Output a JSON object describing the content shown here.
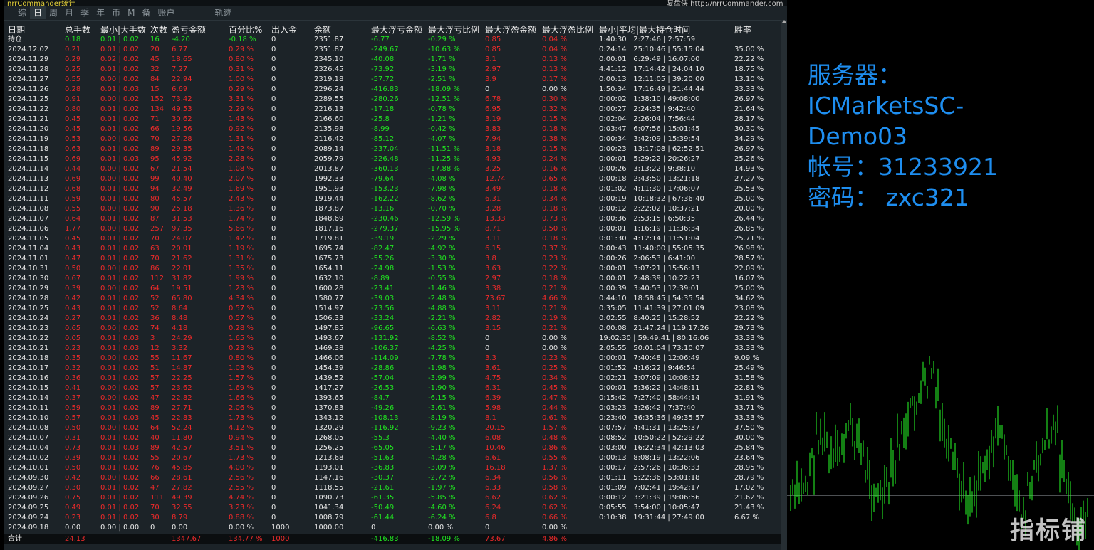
{
  "window": {
    "title_snippet": "nrrCommander统计",
    "site_snippet": "复盘侠 http://nrrCommander.com"
  },
  "tabs": [
    "综",
    "日",
    "周",
    "月",
    "季",
    "年",
    "币",
    "M",
    "备",
    "账户",
    "轨迹"
  ],
  "active_tab": "日",
  "headers": [
    "日期",
    "总手数",
    "最小|大手数",
    "次数",
    "盈亏金额",
    "百分比%",
    "出入金",
    "余额",
    "最大浮亏金额",
    "最大浮亏比例",
    "最大浮盈金额",
    "最大浮盈比例",
    "最小|平均|最大持仓时间",
    "胜率"
  ],
  "position_row": [
    "持仓",
    "0.18",
    "0.01 | 0.02",
    "16",
    "-4.20",
    "-0.18 %",
    "0",
    "2351.87",
    "-6.77",
    "-0.29 %",
    "0.85",
    "0.04 %",
    "1:40:30 | 2:27:46 | 2:57:59",
    ""
  ],
  "rows": [
    [
      "2024.12.02",
      "0.21",
      "0.01 | 0.02",
      "20",
      "6.77",
      "0.29 %",
      "0",
      "2351.87",
      "-249.67",
      "-10.63 %",
      "0.85",
      "0.04 %",
      "0:24:14 | 25:10:46 | 55:15:04",
      "35.00 %"
    ],
    [
      "2024.11.29",
      "0.29",
      "0.02 | 0.02",
      "45",
      "18.65",
      "0.80 %",
      "0",
      "2345.10",
      "-40.08",
      "-1.71 %",
      "3.1",
      "0.13 %",
      "0:00:01 | 6:29:49 | 16:07:00",
      "22.22 %"
    ],
    [
      "2024.11.28",
      "0.25",
      "0.01 | 0.02",
      "32",
      "7.27",
      "0.31 %",
      "0",
      "2326.45",
      "-73.92",
      "-3.19 %",
      "2.97",
      "0.13 %",
      "4:41:12 | 17:14:42 | 24:04:10",
      "18.75 %"
    ],
    [
      "2024.11.27",
      "0.55",
      "0.00 | 0.02",
      "84",
      "22.94",
      "1.00 %",
      "0",
      "2319.18",
      "-57.72",
      "-2.51 %",
      "3.9",
      "0.17 %",
      "0:00:13 | 12:11:05 | 39:20:00",
      "13.10 %"
    ],
    [
      "2024.11.26",
      "0.28",
      "0.01 | 0.03",
      "15",
      "6.69",
      "0.29 %",
      "0",
      "2296.24",
      "-416.83",
      "-18.09 %",
      "0",
      "0.00 %",
      "1:50:34 | 17:16:49 | 21:44:44",
      "33.33 %"
    ],
    [
      "2024.11.25",
      "0.91",
      "0.00 | 0.02",
      "152",
      "73.42",
      "3.31 %",
      "0",
      "2289.55",
      "-280.26",
      "-12.51 %",
      "6.78",
      "0.30 %",
      "0:00:02 | 1:38:10 | 49:08:00",
      "26.97 %"
    ],
    [
      "2024.11.22",
      "0.80",
      "0.01 | 0.02",
      "134",
      "49.53",
      "2.29 %",
      "0",
      "2216.13",
      "-17.18",
      "-0.78 %",
      "6.95",
      "0.32 %",
      "0:00:27 | 2:24:35 | 9:42:40",
      "21.64 %"
    ],
    [
      "2024.11.21",
      "0.45",
      "0.01 | 0.02",
      "71",
      "30.62",
      "1.43 %",
      "0",
      "2166.60",
      "-25.8",
      "-1.21 %",
      "3.19",
      "0.15 %",
      "0:02:04 | 2:26:04 | 7:56:44",
      "28.17 %"
    ],
    [
      "2024.11.20",
      "0.45",
      "0.01 | 0.02",
      "66",
      "19.56",
      "0.92 %",
      "0",
      "2135.98",
      "-8.99",
      "-0.42 %",
      "3.83",
      "0.18 %",
      "0:03:47 | 6:07:56 | 15:01:45",
      "30.30 %"
    ],
    [
      "2024.11.19",
      "0.53",
      "0.00 | 0.02",
      "70",
      "27.28",
      "1.31 %",
      "0",
      "2116.42",
      "-85.12",
      "-4.07 %",
      "7.94",
      "0.38 %",
      "0:00:34 | 3:42:09 | 15:39:54",
      "34.29 %"
    ],
    [
      "2024.11.18",
      "0.63",
      "0.01 | 0.02",
      "89",
      "29.35",
      "1.42 %",
      "0",
      "2089.14",
      "-237.04",
      "-11.51 %",
      "3.18",
      "0.15 %",
      "0:00:23 | 13:17:08 | 62:52:51",
      "26.97 %"
    ],
    [
      "2024.11.15",
      "0.69",
      "0.01 | 0.03",
      "95",
      "45.92",
      "2.28 %",
      "0",
      "2059.79",
      "-226.48",
      "-11.25 %",
      "4.93",
      "0.24 %",
      "0:00:01 | 5:29:22 | 20:26:27",
      "25.26 %"
    ],
    [
      "2024.11.14",
      "0.44",
      "0.00 | 0.02",
      "67",
      "21.54",
      "1.08 %",
      "0",
      "2013.87",
      "-360.13",
      "-17.88 %",
      "3.25",
      "0.16 %",
      "0:00:26 | 3:13:22 | 9:38:10",
      "14.93 %"
    ],
    [
      "2024.11.13",
      "0.69",
      "0.00 | 0.02",
      "99",
      "40.40",
      "2.07 %",
      "0",
      "1992.33",
      "-79.64",
      "-4.08 %",
      "12.74",
      "0.65 %",
      "0:00:18 | 2:43:50 | 13:21:18",
      "27.27 %"
    ],
    [
      "2024.11.12",
      "0.68",
      "0.01 | 0.02",
      "94",
      "32.49",
      "1.69 %",
      "0",
      "1951.93",
      "-153.23",
      "-7.98 %",
      "3.49",
      "0.18 %",
      "0:01:02 | 4:11:30 | 17:06:07",
      "25.53 %"
    ],
    [
      "2024.11.11",
      "0.59",
      "0.01 | 0.02",
      "80",
      "45.57",
      "2.43 %",
      "0",
      "1919.44",
      "-162.22",
      "-8.62 %",
      "6.31",
      "0.34 %",
      "0:00:19 | 10:18:32 | 67:36:40",
      "25.00 %"
    ],
    [
      "2024.11.08",
      "0.55",
      "0.00 | 0.02",
      "90",
      "25.18",
      "1.36 %",
      "0",
      "1873.87",
      "-13.16",
      "-0.70 %",
      "3.28",
      "0.18 %",
      "0:00:12 | 2:22:02 | 10:37:21",
      "20.00 %"
    ],
    [
      "2024.11.07",
      "0.64",
      "0.01 | 0.02",
      "87",
      "31.53",
      "1.74 %",
      "0",
      "1848.69",
      "-230.46",
      "-12.59 %",
      "13.33",
      "0.73 %",
      "0:00:36 | 2:53:15 | 6:50:35",
      "26.44 %"
    ],
    [
      "2024.11.06",
      "1.77",
      "0.00 | 0.02",
      "257",
      "97.35",
      "5.66 %",
      "0",
      "1817.16",
      "-279.37",
      "-15.95 %",
      "8.71",
      "0.50 %",
      "0:00:01 | 1:16:19 | 11:36:34",
      "26.85 %"
    ],
    [
      "2024.11.05",
      "0.45",
      "0.01 | 0.02",
      "70",
      "24.07",
      "1.42 %",
      "0",
      "1719.81",
      "-39.19",
      "-2.29 %",
      "3.11",
      "0.18 %",
      "0:01:30 | 4:12:14 | 11:51:04",
      "25.71 %"
    ],
    [
      "2024.11.04",
      "0.43",
      "0.01 | 0.02",
      "63",
      "20.01",
      "1.19 %",
      "0",
      "1695.74",
      "-82.47",
      "-4.92 %",
      "6.15",
      "0.37 %",
      "0:00:43 | 11:40:00 | 55:05:35",
      "26.98 %"
    ],
    [
      "2024.11.01",
      "0.47",
      "0.01 | 0.02",
      "70",
      "21.62",
      "1.31 %",
      "0",
      "1675.73",
      "-55.26",
      "-3.30 %",
      "3.8",
      "0.23 %",
      "0:00:26 | 2:06:53 | 6:41:00",
      "28.57 %"
    ],
    [
      "2024.10.31",
      "0.50",
      "0.00 | 0.02",
      "86",
      "22.01",
      "1.35 %",
      "0",
      "1654.11",
      "-24.98",
      "-1.53 %",
      "3.63",
      "0.22 %",
      "0:00:01 | 3:07:21 | 15:56:13",
      "22.09 %"
    ],
    [
      "2024.10.30",
      "0.67",
      "0.01 | 0.02",
      "112",
      "31.82",
      "1.99 %",
      "0",
      "1632.10",
      "-8.89",
      "-0.55 %",
      "2.97",
      "0.18 %",
      "0:00:01 | 2:48:39 | 10:22:23",
      "16.07 %"
    ],
    [
      "2024.10.29",
      "0.39",
      "0.00 | 0.02",
      "64",
      "19.51",
      "1.23 %",
      "0",
      "1600.28",
      "-23.41",
      "-1.46 %",
      "3.38",
      "0.21 %",
      "0:00:39 | 3:40:53 | 12:39:01",
      "25.00 %"
    ],
    [
      "2024.10.28",
      "0.42",
      "0.01 | 0.02",
      "52",
      "65.80",
      "4.34 %",
      "0",
      "1580.77",
      "-39.03",
      "-2.48 %",
      "73.67",
      "4.66 %",
      "0:44:10 | 18:58:45 | 54:35:54",
      "34.62 %"
    ],
    [
      "2024.10.25",
      "0.43",
      "0.01 | 0.02",
      "52",
      "8.64",
      "0.57 %",
      "0",
      "1514.97",
      "-73.56",
      "-4.88 %",
      "3.11",
      "0.21 %",
      "0:35:05 | 11:41:39 | 27:01:09",
      "23.08 %"
    ],
    [
      "2024.10.24",
      "0.27",
      "0.01 | 0.02",
      "36",
      "8.48",
      "0.57 %",
      "0",
      "1506.33",
      "-33.24",
      "-2.21 %",
      "2.82",
      "0.19 %",
      "0:02:55 | 8:40:25 | 15:28:52",
      "22.22 %"
    ],
    [
      "2024.10.23",
      "0.65",
      "0.00 | 0.02",
      "74",
      "4.18",
      "0.28 %",
      "0",
      "1497.85",
      "-96.65",
      "-6.63 %",
      "3.15",
      "0.21 %",
      "0:00:08 | 21:47:24 | 119:17:26",
      "29.73 %"
    ],
    [
      "2024.10.22",
      "0.05",
      "0.01 | 0.03",
      "3",
      "24.29",
      "1.65 %",
      "0",
      "1493.67",
      "-131.92",
      "-8.52 %",
      "0",
      "0.00 %",
      "19:02:30 | 59:49:41 | 80:16:06",
      "33.33 %"
    ],
    [
      "2024.10.21",
      "0.23",
      "0.01 | 0.03",
      "12",
      "3.32",
      "0.23 %",
      "0",
      "1469.38",
      "-106.37",
      "-4.25 %",
      "0",
      "0.00 %",
      "2:05:55 | 50:01:04 | 73:10:07",
      "33.33 %"
    ],
    [
      "2024.10.18",
      "0.35",
      "0.00 | 0.02",
      "55",
      "11.67",
      "0.80 %",
      "0",
      "1466.06",
      "-114.09",
      "-7.78 %",
      "3.3",
      "0.23 %",
      "0:00:01 | 7:40:48 | 12:06:49",
      "9.09 %"
    ],
    [
      "2024.10.17",
      "0.32",
      "0.01 | 0.02",
      "51",
      "14.87",
      "1.03 %",
      "0",
      "1454.39",
      "-28.86",
      "-1.98 %",
      "3.61",
      "0.25 %",
      "0:01:52 | 4:16:22 | 9:46:54",
      "25.49 %"
    ],
    [
      "2024.10.16",
      "0.36",
      "0.01 | 0.02",
      "57",
      "22.25",
      "1.57 %",
      "0",
      "1439.52",
      "-57.04",
      "-3.99 %",
      "4.75",
      "0.34 %",
      "0:02:21 | 3:07:09 | 10:08:32",
      "31.58 %"
    ],
    [
      "2024.10.15",
      "0.41",
      "0.00 | 0.02",
      "57",
      "23.62",
      "1.69 %",
      "0",
      "1417.27",
      "-26.53",
      "-1.90 %",
      "6.31",
      "0.45 %",
      "0:00:01 | 5:36:22 | 14:48:11",
      "22.81 %"
    ],
    [
      "2024.10.14",
      "0.37",
      "0.00 | 0.02",
      "47",
      "22.82",
      "1.66 %",
      "0",
      "1393.65",
      "-84.7",
      "-6.15 %",
      "6.39",
      "0.47 %",
      "0:15:42 | 7:27:40 | 58:44:14",
      "31.91 %"
    ],
    [
      "2024.10.11",
      "0.59",
      "0.01 | 0.02",
      "89",
      "27.71",
      "2.06 %",
      "0",
      "1370.83",
      "-49.26",
      "-3.61 %",
      "5.98",
      "0.44 %",
      "0:03:23 | 3:26:42 | 7:37:40",
      "33.71 %"
    ],
    [
      "2024.10.10",
      "0.57",
      "0.01 | 0.03",
      "45",
      "22.83",
      "1.73 %",
      "0",
      "1343.12",
      "-108.13",
      "-8.19 %",
      "8.1",
      "0.61 %",
      "0:23:40 | 36:35:36 | 49:35:57",
      "33.33 %"
    ],
    [
      "2024.10.08",
      "0.50",
      "0.00 | 0.02",
      "64",
      "52.24",
      "4.12 %",
      "0",
      "1320.29",
      "-116.92",
      "-9.23 %",
      "20.15",
      "1.57 %",
      "0:07:57 | 4:41:31 | 13:25:37",
      "37.50 %"
    ],
    [
      "2024.10.07",
      "0.31",
      "0.01 | 0.02",
      "40",
      "11.80",
      "0.94 %",
      "0",
      "1268.05",
      "-55.3",
      "-4.40 %",
      "6.08",
      "0.48 %",
      "0:08:52 | 10:50:22 | 52:29:22",
      "30.00 %"
    ],
    [
      "2024.10.04",
      "0.73",
      "0.01 | 0.03",
      "89",
      "42.57",
      "3.51 %",
      "0",
      "1256.25",
      "-65.05",
      "-5.17 %",
      "10.46",
      "0.86 %",
      "0:03:00 | 16:22:34 | 42:13:03",
      "25.84 %"
    ],
    [
      "2024.10.02",
      "0.39",
      "0.01 | 0.02",
      "55",
      "20.67",
      "1.73 %",
      "0",
      "1213.68",
      "-51.63",
      "-4.28 %",
      "6.61",
      "0.55 %",
      "0:00:13 | 8:08:19 | 13:22:06",
      "23.64 %"
    ],
    [
      "2024.10.01",
      "0.50",
      "0.01 | 0.02",
      "76",
      "45.85",
      "4.00 %",
      "0",
      "1193.01",
      "-36.83",
      "-3.09 %",
      "16.18",
      "1.37 %",
      "0:00:17 | 2:57:26 | 10:36:33",
      "28.95 %"
    ],
    [
      "2024.09.30",
      "0.42",
      "0.00 | 0.02",
      "66",
      "28.61",
      "2.56 %",
      "0",
      "1147.16",
      "-30.37",
      "-2.72 %",
      "6.34",
      "0.56 %",
      "0:01:11 | 5:22:36 | 53:01:18",
      "28.79 %"
    ],
    [
      "2024.09.27",
      "0.30",
      "0.01 | 0.02",
      "47",
      "27.82",
      "2.55 %",
      "0",
      "1118.55",
      "-21.61",
      "-1.97 %",
      "6.33",
      "0.58 %",
      "0:01:09 | 7:02:41 | 19:42:17",
      "17.02 %"
    ],
    [
      "2024.09.26",
      "0.75",
      "0.01 | 0.02",
      "111",
      "49.39",
      "4.74 %",
      "0",
      "1090.73",
      "-61.35",
      "-5.85 %",
      "6.62",
      "0.62 %",
      "0:00:12 | 3:21:39 | 19:06:56",
      "21.62 %"
    ],
    [
      "2024.09.25",
      "0.49",
      "0.01 | 0.02",
      "70",
      "32.55",
      "3.23 %",
      "0",
      "1041.34",
      "-50.49",
      "-4.60 %",
      "6.24",
      "0.62 %",
      "0:05:55 | 3:54:00 | 10:05:47",
      "21.43 %"
    ],
    [
      "2024.09.24",
      "0.23",
      "0.01 | 0.02",
      "30",
      "8.79",
      "0.88 %",
      "0",
      "1008.79",
      "-61.44",
      "-6.24 %",
      "6.8",
      "0.66 %",
      "0:10:38 | 19:31:44 | 27:49:00",
      "6.67 %"
    ],
    [
      "2024.09.18",
      "0.00",
      "0.00 | 0.00",
      "0",
      "0.00",
      "0.00 %",
      "1000",
      "1000.00",
      "0",
      "0.00 %",
      "0",
      "0.00 %",
      "",
      ""
    ]
  ],
  "total_row": [
    "合计",
    "24.13",
    "",
    "",
    "1347.67",
    "134.77 %",
    "1000",
    "",
    "-416.83",
    "-18.09 %",
    "73.67",
    "4.86 %",
    "",
    ""
  ],
  "info": {
    "line1": "服务器：",
    "line2": "ICMarketsSC-",
    "line3": "Demo03",
    "line4": "帐号：31233921",
    "line5": "密码：  zxc321"
  },
  "watermark": "指标铺",
  "colors": {
    "profit": "#ef2a2a",
    "loss": "#21e321",
    "accent": "#1e8ef0",
    "candle": "#27ff27"
  }
}
